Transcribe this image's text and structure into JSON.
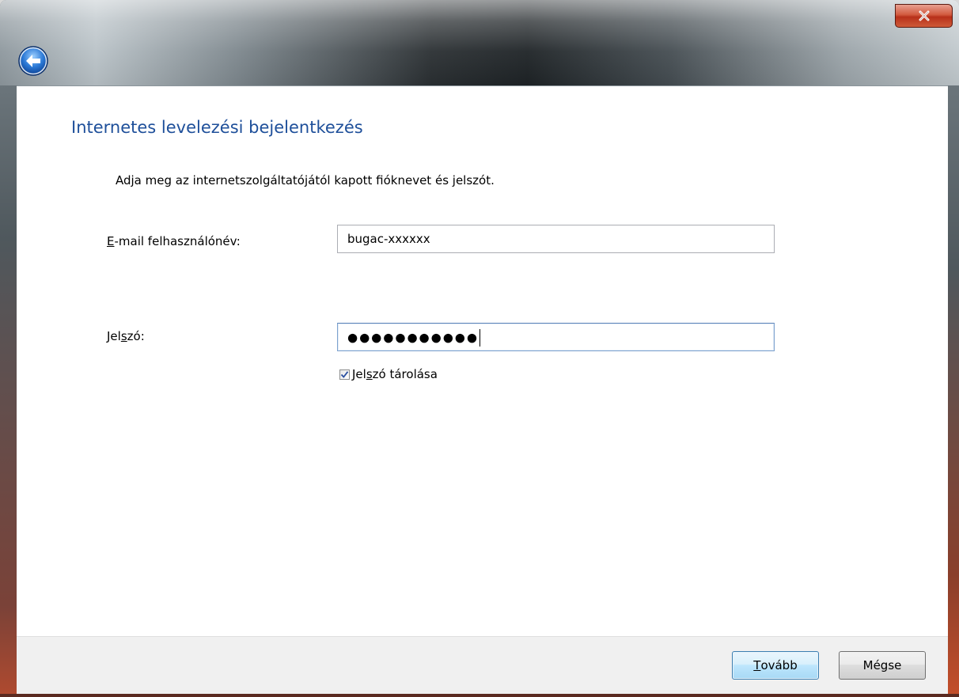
{
  "window": {
    "close_label": "X"
  },
  "page": {
    "title": "Internetes levelezési bejelentkezés",
    "instruction": "Adja meg az internetszolgáltatójától kapott fióknevet és jelszót."
  },
  "username": {
    "label_accel": "E",
    "label_rest": "-mail felhasználónév:",
    "value": "bugac-xxxxxx"
  },
  "password": {
    "label_pre": "Jel",
    "label_accel": "s",
    "label_post": "zó:",
    "masked_value": "●●●●●●●●●●●"
  },
  "remember": {
    "checked": true,
    "label_pre": "Jel",
    "label_accel": "s",
    "label_post": "zó tárolása"
  },
  "buttons": {
    "next_accel": "T",
    "next_rest": "ovább",
    "cancel": "Mégse"
  },
  "colors": {
    "title": "#1e4f9a",
    "close_button": "#c44e2a",
    "default_button_border": "#3c7fb1"
  },
  "icons": {
    "back": "back-arrow-icon",
    "close": "close-icon",
    "check": "check-icon"
  }
}
